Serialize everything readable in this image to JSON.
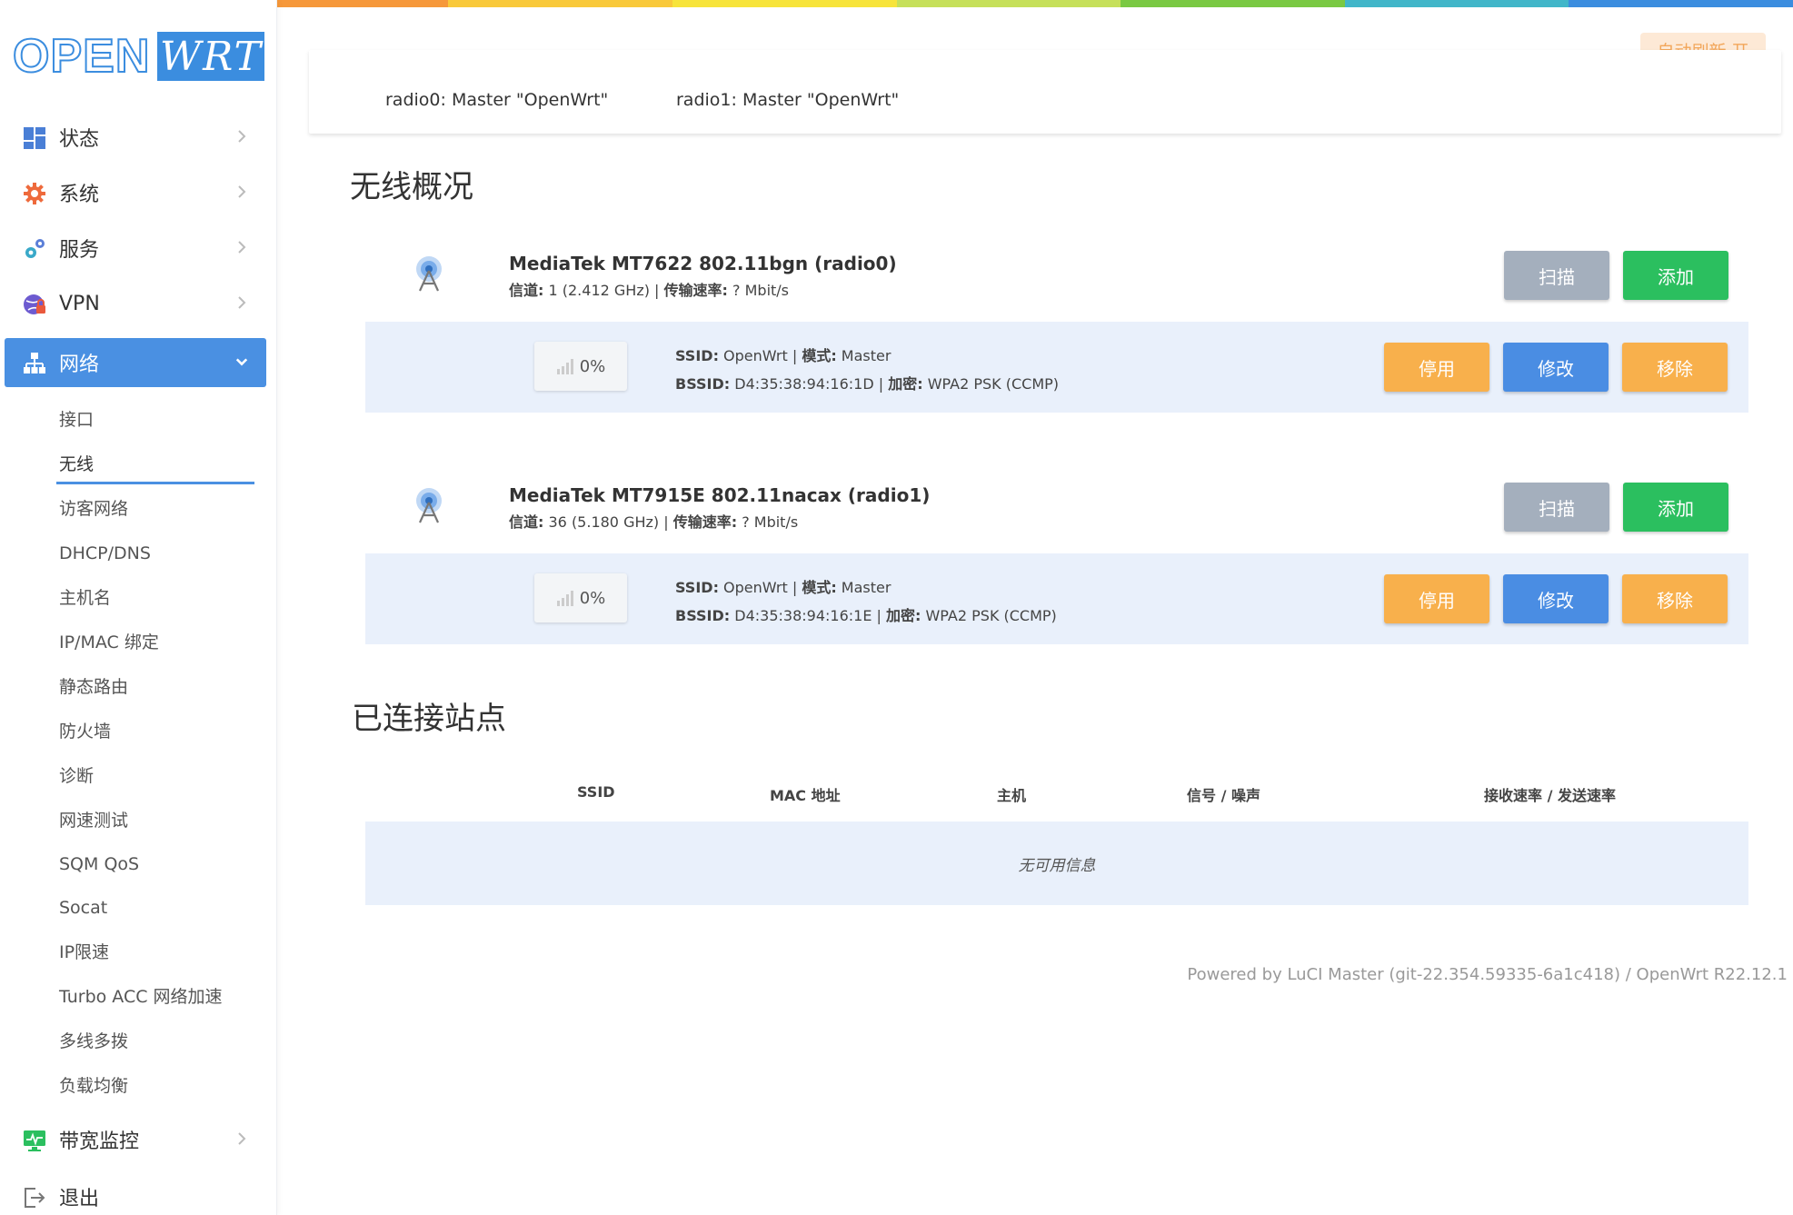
{
  "rainbow": [
    "#e9593d",
    "#f6983a",
    "#f9c93a",
    "#f7e43a",
    "#c6e05a",
    "#7ac943",
    "#41b6c9",
    "#3b8ddf"
  ],
  "brand": {
    "logo_left": "OPEN",
    "logo_right": "WRT",
    "accent": "#4a90e2"
  },
  "sidebar": {
    "items": [
      {
        "label": "状态",
        "icon": "dashboard-icon"
      },
      {
        "label": "系统",
        "icon": "gear-icon"
      },
      {
        "label": "服务",
        "icon": "gears-icon"
      },
      {
        "label": "VPN",
        "icon": "globe-lock-icon"
      },
      {
        "label": "网络",
        "icon": "network-icon",
        "active": true
      },
      {
        "label": "带宽监控",
        "icon": "monitor-chart-icon"
      },
      {
        "label": "退出",
        "icon": "logout-icon"
      }
    ],
    "network_sub": [
      "接口",
      "无线",
      "访客网络",
      "DHCP/DNS",
      "主机名",
      "IP/MAC 绑定",
      "静态路由",
      "防火墙",
      "诊断",
      "网速测试",
      "SQM QoS",
      "Socat",
      "IP限速",
      "Turbo ACC 网络加速",
      "多线多拨",
      "负载均衡"
    ],
    "active_sub": "无线"
  },
  "autorefresh": "自动刷新 开",
  "radio_tabs": [
    "radio0: Master \"OpenWrt\"",
    "radio1: Master \"OpenWrt\""
  ],
  "overview_title": "无线概况",
  "labels": {
    "channel": "信道:",
    "bitrate": "传输速率:",
    "ssid": "SSID:",
    "mode": "模式:",
    "bssid": "BSSID:",
    "encryption": "加密:",
    "sep": " | "
  },
  "buttons": {
    "scan": "扫描",
    "add": "添加",
    "disable": "停用",
    "edit": "修改",
    "remove": "移除"
  },
  "devices": [
    {
      "name": "MediaTek MT7622 802.11bgn (radio0)",
      "channel": " 1 (2.412 GHz)",
      "bitrate": " ? Mbit/s",
      "net": {
        "signal": "0%",
        "ssid": " OpenWrt",
        "mode": " Master",
        "bssid": " D4:35:38:94:16:1D",
        "encryption": " WPA2 PSK (CCMP)"
      }
    },
    {
      "name": "MediaTek MT7915E 802.11nacax (radio1)",
      "channel": " 36 (5.180 GHz)",
      "bitrate": " ? Mbit/s",
      "net": {
        "signal": "0%",
        "ssid": " OpenWrt",
        "mode": " Master",
        "bssid": " D4:35:38:94:16:1E",
        "encryption": " WPA2 PSK (CCMP)"
      }
    }
  ],
  "assoc": {
    "title": "已连接站点",
    "columns": [
      "SSID",
      "MAC 地址",
      "主机",
      "信号 / 噪声",
      "接收速率 / 发送速率"
    ],
    "empty": "无可用信息"
  },
  "footer": "Powered by LuCI Master (git-22.354.59335-6a1c418) / OpenWrt R22.12.1"
}
